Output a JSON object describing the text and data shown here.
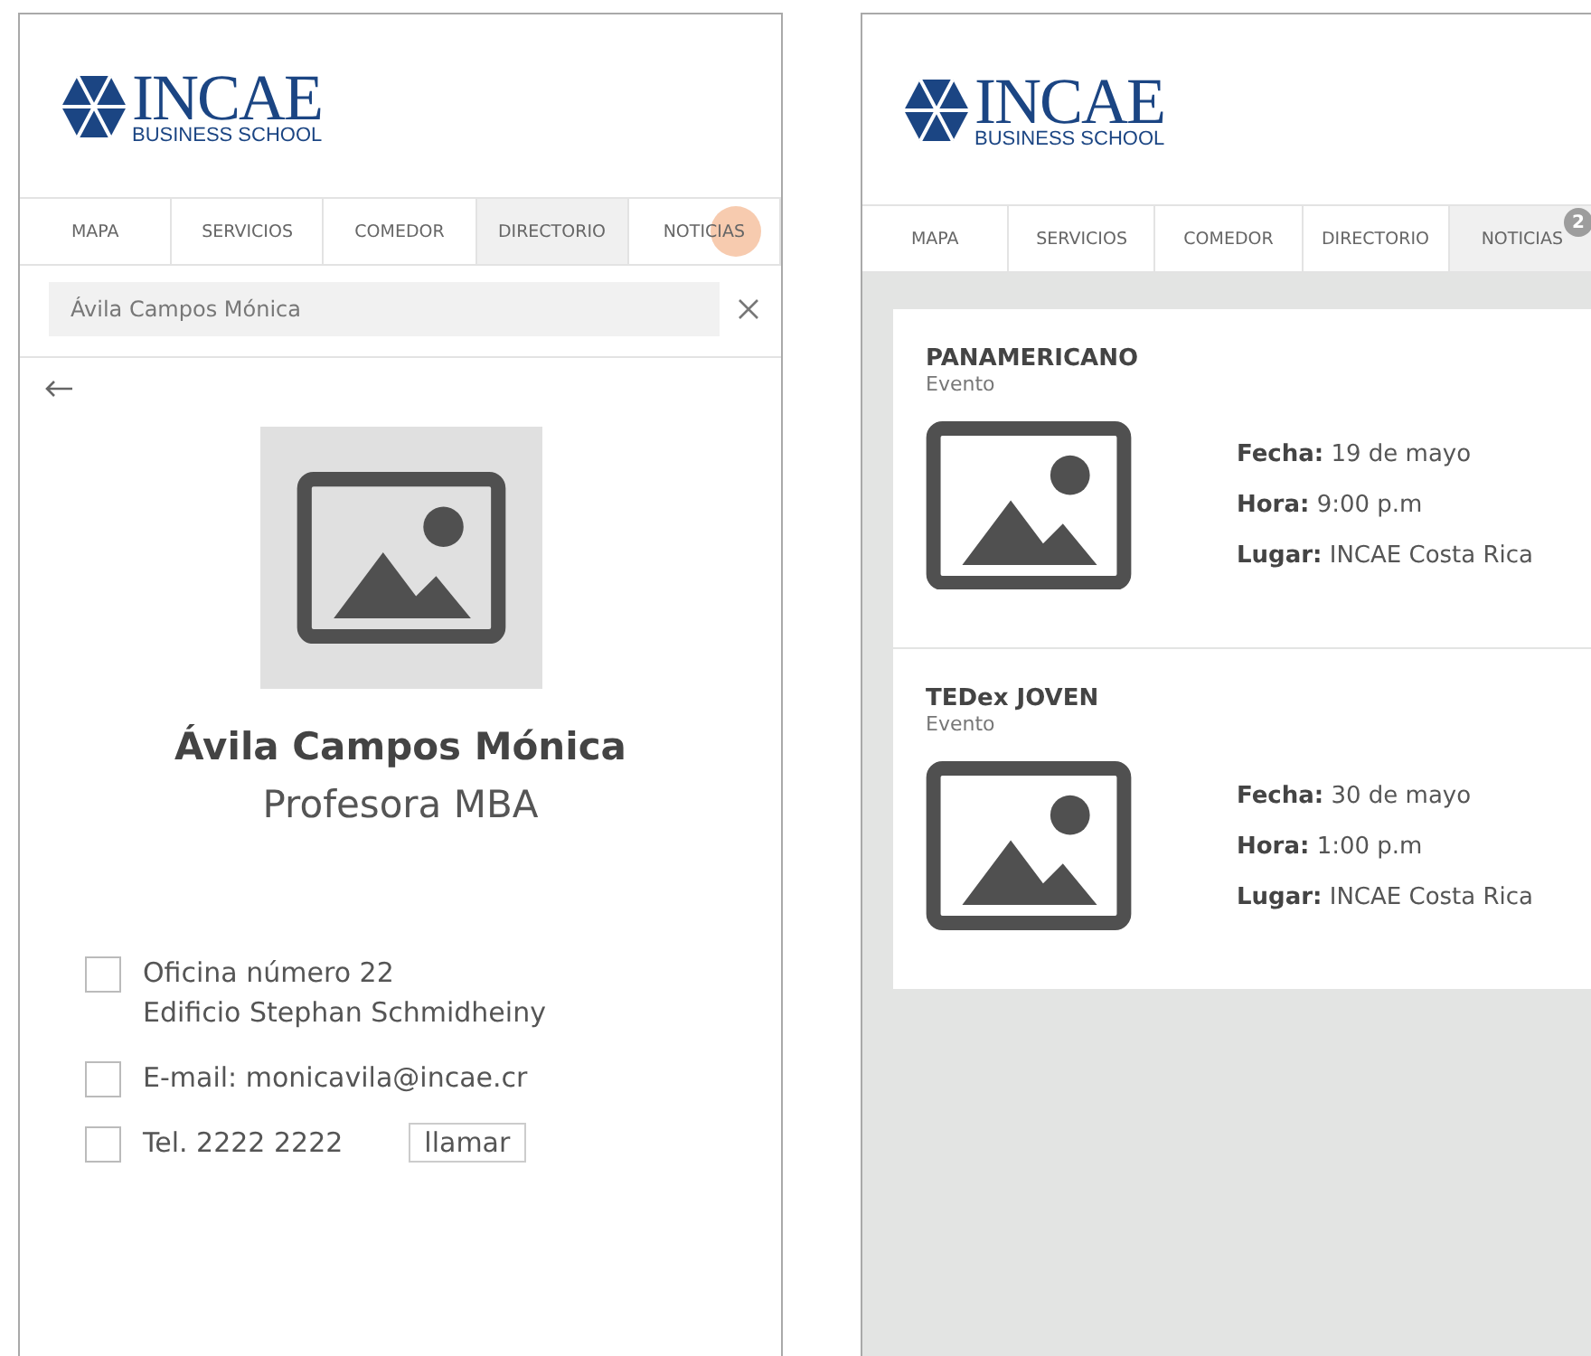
{
  "screens": [
    {
      "logo": {
        "name": "INCAE",
        "subtitle": "BUSINESS SCHOOL"
      },
      "tabs": [
        {
          "label": "MAPA",
          "selected": false,
          "tapped": false
        },
        {
          "label": "SERVICIOS",
          "selected": false,
          "tapped": false
        },
        {
          "label": "COMEDOR",
          "selected": false,
          "tapped": false
        },
        {
          "label": "DIRECTORIO",
          "selected": true,
          "tapped": false
        },
        {
          "label": "NOTICIAS",
          "selected": false,
          "tapped": true
        }
      ],
      "search": {
        "value": "Ávila Campos Mónica"
      },
      "profile": {
        "name": "Ávila Campos Mónica",
        "role": "Profesora MBA",
        "contacts": [
          {
            "lines": [
              "Oficina número 22",
              "Edificio Stephan Schmidheiny"
            ],
            "checked": false
          },
          {
            "lines": [
              "E-mail: monicavila@incae.cr"
            ],
            "checked": false
          },
          {
            "lines": [
              "Tel. 2222 2222"
            ],
            "checked": false,
            "action": "llamar"
          }
        ]
      }
    },
    {
      "logo": {
        "name": "INCAE",
        "subtitle": "BUSINESS SCHOOL"
      },
      "tabs": [
        {
          "label": "MAPA",
          "selected": false,
          "tapped": false
        },
        {
          "label": "SERVICIOS",
          "selected": false,
          "tapped": false
        },
        {
          "label": "COMEDOR",
          "selected": false,
          "tapped": false
        },
        {
          "label": "DIRECTORIO",
          "selected": false,
          "tapped": false
        },
        {
          "label": "NOTICIAS",
          "selected": true,
          "tapped": false,
          "badge": "2"
        }
      ],
      "news": [
        {
          "title": "PANAMERICANO",
          "category": "Evento",
          "details": [
            "**Fecha:** 19 de mayo",
            "**Hora:** 9:00 p.m",
            "**Lugar:** INCAE Costa Rica"
          ]
        },
        {
          "title": "TEDex JOVEN",
          "category": "Evento",
          "details": [
            "**Fecha:** 30 de mayo",
            "**Hora:** 1:00 p.m",
            "**Lugar:** INCAE Costa Rica"
          ]
        }
      ]
    }
  ]
}
